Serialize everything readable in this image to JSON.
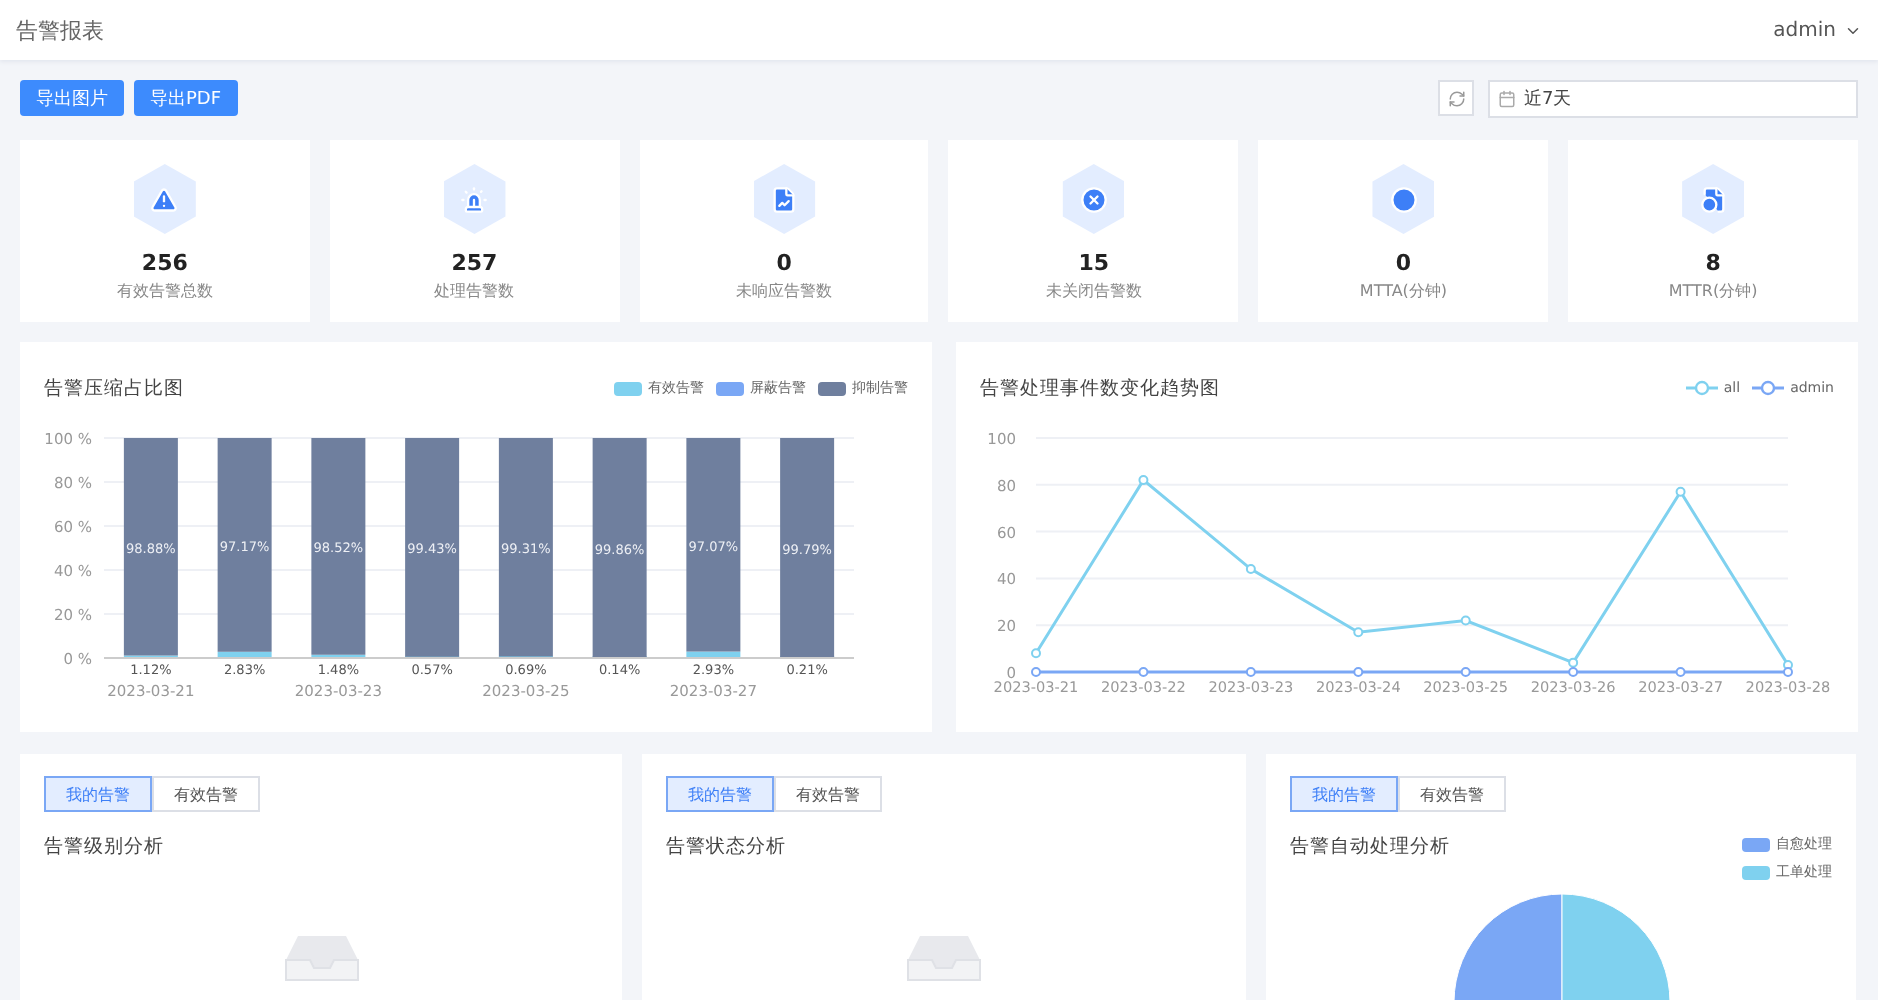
{
  "header": {
    "title": "告警报表",
    "user": "admin"
  },
  "toolbar": {
    "buttons": [
      "导出图片",
      "导出PDF"
    ],
    "date_range": {
      "value": "近7天"
    }
  },
  "stats": [
    {
      "value": "256",
      "label": "有效告警总数"
    },
    {
      "value": "257",
      "label": "处理告警数"
    },
    {
      "value": "0",
      "label": "未响应告警数"
    },
    {
      "value": "15",
      "label": "未关闭告警数"
    },
    {
      "value": "0",
      "label": "MTTA(分钟)"
    },
    {
      "value": "8",
      "label": "MTTR(分钟)"
    }
  ],
  "compression_chart": {
    "title": "告警压缩占比图",
    "chart_data": {
      "type": "bar",
      "stacked": true,
      "grid": true,
      "legend": "top-right",
      "categories": [
        "2023-03-21",
        null,
        "2023-03-23",
        null,
        "2023-03-25",
        null,
        "2023-03-27",
        null
      ],
      "yticks": [
        {
          "value": 0,
          "label": "0 %"
        },
        {
          "value": 20,
          "label": "20 %"
        },
        {
          "value": 40,
          "label": "40 %"
        },
        {
          "value": 60,
          "label": "60 %"
        },
        {
          "value": 80,
          "label": "80 %"
        },
        {
          "value": 100,
          "label": "100 %"
        }
      ],
      "ylim": [
        0,
        100
      ],
      "series": [
        {
          "name": "有效告警",
          "color": "#7fd1ef",
          "values": [
            1.12,
            2.83,
            1.48,
            0.57,
            0.69,
            0.14,
            2.93,
            0.21
          ],
          "value_labels": [
            "1.12%",
            "2.83%",
            "1.48%",
            "0.57%",
            "0.69%",
            "0.14%",
            "2.93%",
            "0.21%"
          ]
        },
        {
          "name": "屏蔽告警",
          "color": "#7aa7f5",
          "values": [
            0,
            0,
            0,
            0,
            0,
            0,
            0,
            0
          ]
        },
        {
          "name": "抑制告警",
          "color": "#6f7f9e",
          "values": [
            98.88,
            97.17,
            98.52,
            99.43,
            99.31,
            99.86,
            97.07,
            99.79
          ],
          "value_labels": [
            "98.88%",
            "97.17%",
            "98.52%",
            "99.43%",
            "99.31%",
            "99.86%",
            "97.07%",
            "99.79%"
          ]
        }
      ]
    }
  },
  "trend_chart": {
    "title": "告警处理事件数变化趋势图",
    "chart_data": {
      "type": "line",
      "grid": true,
      "legend": "top-right",
      "categories": [
        "2023-03-21",
        "2023-03-22",
        "2023-03-23",
        "2023-03-24",
        "2023-03-25",
        "2023-03-26",
        "2023-03-27",
        "2023-03-28"
      ],
      "yticks": [
        0,
        20,
        40,
        60,
        80,
        100
      ],
      "ylim": [
        0,
        100
      ],
      "series": [
        {
          "name": "all",
          "color": "#7fd1ef",
          "marker": "circle",
          "values": [
            8,
            82,
            44,
            17,
            22,
            4,
            77,
            3
          ]
        },
        {
          "name": "admin",
          "color": "#7aa7f5",
          "marker": "circle",
          "values": [
            0,
            0,
            0,
            0,
            0,
            0,
            0,
            0
          ]
        }
      ]
    }
  },
  "analysis_panels": [
    {
      "kind": "empty",
      "title": "告警级别分析",
      "tabs": [
        {
          "label": "我的告警",
          "selected": true
        },
        {
          "label": "有效告警",
          "selected": false
        }
      ]
    },
    {
      "kind": "empty",
      "title": "告警状态分析",
      "tabs": [
        {
          "label": "我的告警",
          "selected": true
        },
        {
          "label": "有效告警",
          "selected": false
        }
      ]
    },
    {
      "kind": "pie",
      "title": "告警自动处理分析",
      "tabs": [
        {
          "label": "我的告警",
          "selected": true
        },
        {
          "label": "有效告警",
          "selected": false
        }
      ],
      "chart_data": {
        "type": "pie",
        "legend": "top-right",
        "categories": [
          "自愈处理",
          "工单处理"
        ],
        "values": [
          50,
          50
        ],
        "colors": [
          "#7aa7f5",
          "#7fd1ef"
        ]
      }
    }
  ]
}
